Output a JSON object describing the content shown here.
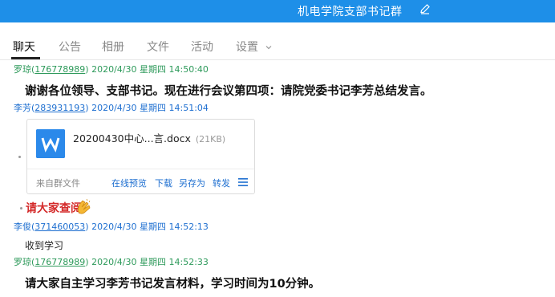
{
  "window": {
    "title": "机电学院支部书记群"
  },
  "tabs": [
    {
      "label": "聊天",
      "active": true
    },
    {
      "label": "公告"
    },
    {
      "label": "相册"
    },
    {
      "label": "文件"
    },
    {
      "label": "活动"
    },
    {
      "label": "设置"
    }
  ],
  "messages": [
    {
      "sender": "罗琼",
      "uid": "176778989",
      "timestamp": "2020/4/30 星期四 14:50:40",
      "text": "谢谢各位领导、支部书记。现在进行会议第四项：请院党委书记李芳总结发言。"
    },
    {
      "sender": "李芳",
      "uid": "283931193",
      "timestamp": "2020/4/30 星期四 14:51:04"
    },
    {
      "sender": "李俊",
      "uid": "371460053",
      "timestamp": "2020/4/30 星期四 14:52:13",
      "text": "收到学习"
    },
    {
      "sender": "罗琼",
      "uid": "176778989",
      "timestamp": "2020/4/30 星期四 14:52:33",
      "text": "请大家自主学习李芳书记发言材料，学习时间为10分钟。"
    }
  ],
  "file_card": {
    "file_name": "20200430中心...言.docx",
    "file_size": "(21KB)",
    "source": "来自群文件",
    "actions": [
      "在线预览",
      "下载",
      "另存为",
      "转发"
    ]
  },
  "red_message": {
    "text": "请大家查阅"
  },
  "colors": {
    "titlebar": "#1e8fe8",
    "link_blue": "#1e6fd0",
    "name_green": "#2e9a5b",
    "red_text": "#d42a2a",
    "word_icon": "#2b89ea"
  },
  "icons": {
    "edit": "pencil-edit-icon",
    "settings_chevron": "chevron-down-icon",
    "file": "word-doc-icon",
    "more": "menu-icon",
    "emoji": "clapping-hands-icon"
  }
}
